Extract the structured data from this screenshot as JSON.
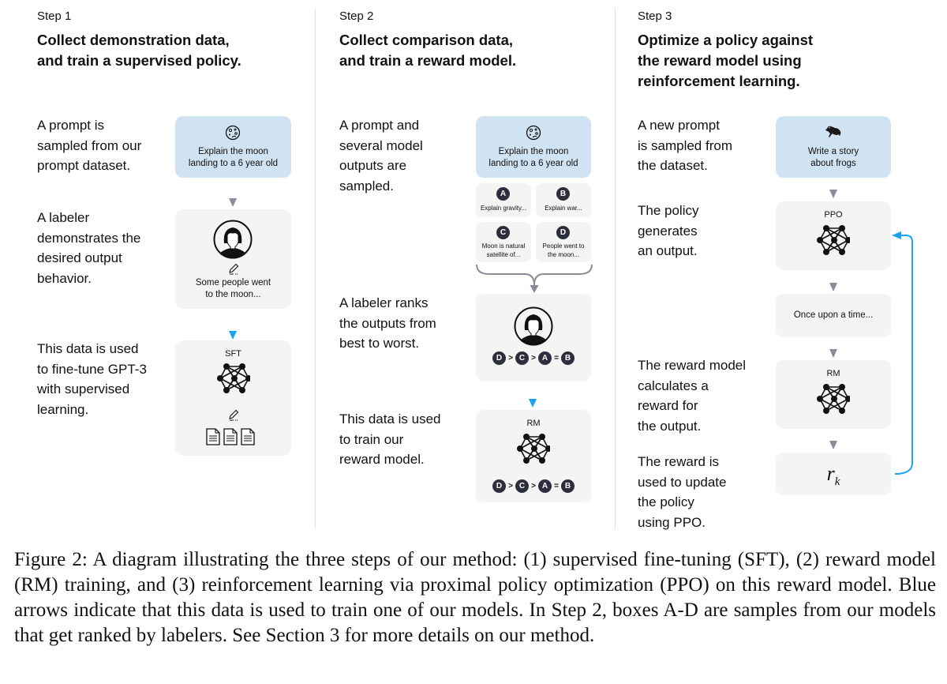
{
  "steps": [
    {
      "label": "Step 1",
      "title": "Collect demonstration data,\nand train a supervised policy.",
      "descriptions": [
        "A prompt is\nsampled from our\nprompt dataset.",
        "A labeler\ndemonstrates the\ndesired output\nbehavior.",
        "This data is used\nto fine-tune GPT-3\nwith supervised\nlearning."
      ],
      "prompt_icon": "moon-icon",
      "prompt_text": "Explain the moon\nlanding to a 6 year old",
      "labeler_icon": "labeler-avatar-icon",
      "demonstration_text": "Some people went\nto the moon...",
      "model_label": "SFT"
    },
    {
      "label": "Step 2",
      "title": "Collect comparison data,\nand train a reward model.",
      "descriptions": [
        "A prompt and\nseveral model\noutputs are\nsampled.",
        "A labeler ranks\nthe outputs from\nbest to worst.",
        "This data is used\nto train our\nreward model."
      ],
      "prompt_icon": "moon-icon",
      "prompt_text": "Explain the moon\nlanding to a 6 year old",
      "outputs": [
        {
          "letter": "A",
          "text": "Explain gravity..."
        },
        {
          "letter": "B",
          "text": "Explain war..."
        },
        {
          "letter": "C",
          "text": "Moon is natural\nsatellite of..."
        },
        {
          "letter": "D",
          "text": "People went to\nthe moon..."
        }
      ],
      "ranking": [
        "D",
        ">",
        "C",
        ">",
        "A",
        "=",
        "B"
      ],
      "model_label": "RM"
    },
    {
      "label": "Step 3",
      "title": "Optimize a policy against\nthe reward model using\nreinforcement learning.",
      "descriptions": [
        "A new prompt\nis sampled from\nthe dataset.",
        "The policy\ngenerates\nan output.",
        "The reward model\ncalculates a\nreward for\nthe output.",
        "The reward is\nused to update\nthe policy\nusing PPO."
      ],
      "prompt_icon": "frog-icon",
      "prompt_text": "Write a story\nabout frogs",
      "policy_label": "PPO",
      "output_text": "Once upon a time...",
      "rm_label": "RM",
      "reward_symbol": "r",
      "reward_subscript": "k"
    }
  ],
  "caption": "Figure 2: A diagram illustrating the three steps of our method: (1) supervised fine-tuning (SFT), (2) reward model (RM) training, and (3) reinforcement learning via proximal policy optimization (PPO) on this reward model. Blue arrows indicate that this data is used to train one of our models. In Step 2, boxes A-D are samples from our models that get ranked by labelers. See Section 3 for more details on our method.",
  "colors": {
    "prompt_box": "#cfe3f2",
    "step_box": "#f4f4f3",
    "gray_arrow": "#8b8a99",
    "blue_arrow": "#1aa3f0",
    "badge": "#2c2e3e"
  }
}
